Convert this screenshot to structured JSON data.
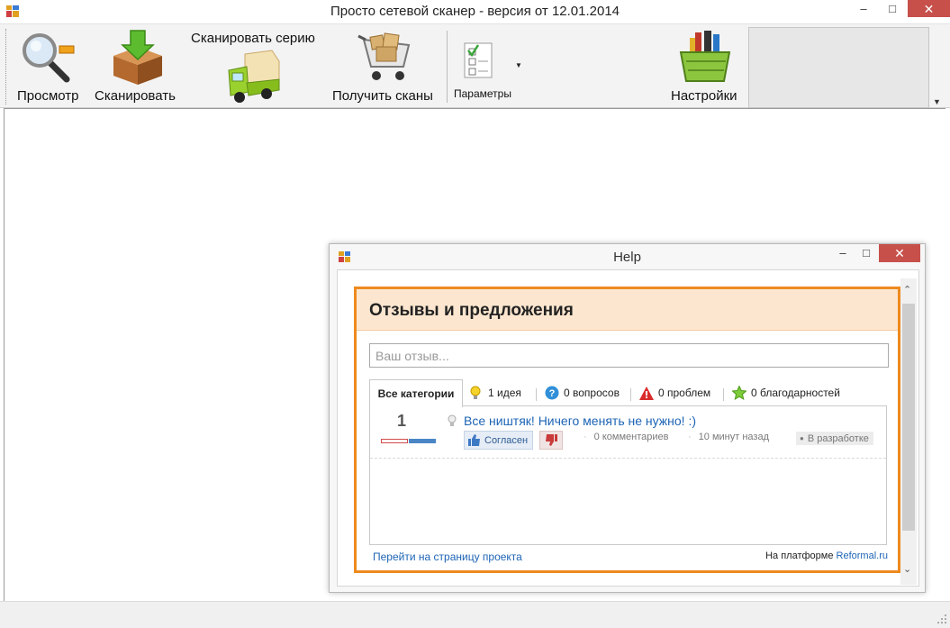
{
  "window": {
    "title": "Просто сетевой сканер - версия от 12.01.2014",
    "minimize": "–",
    "maximize": "□",
    "close": "✕"
  },
  "toolbar": {
    "preview_label": "Просмотр",
    "scan_label": "Сканировать",
    "scan_series_label": "Сканировать серию",
    "get_scans_label": "Получить сканы",
    "params_label": "Параметры",
    "settings_label": "Настройки"
  },
  "help_window": {
    "title": "Help",
    "minimize": "–",
    "maximize": "□",
    "close": "✕"
  },
  "widget": {
    "title": "Отзывы и предложения",
    "input_placeholder": "Ваш отзыв...",
    "tabs": [
      {
        "label": "Все категории"
      },
      {
        "label": "1 идея",
        "icon": "lightbulb-icon"
      },
      {
        "label": "0 вопросов",
        "icon": "question-icon"
      },
      {
        "label": "0 проблем",
        "icon": "warning-icon"
      },
      {
        "label": "0 благодарностей",
        "icon": "star-icon"
      }
    ],
    "item": {
      "votes": "1",
      "title": "Все ништяк! Ничего менять не нужно! :)",
      "agree_label": "Согласен",
      "comments": "0 комментариев",
      "time": "10 минут назад",
      "status": "В разработке"
    },
    "footer": {
      "project_link": "Перейти на страницу проекта",
      "platform_text": "На платформе",
      "platform_link": "Reformal.ru"
    }
  },
  "colors": {
    "accent_orange": "#ee8a1e",
    "header_peach": "#fde6cf",
    "link_blue": "#1d64b5",
    "close_red": "#c7504b"
  }
}
